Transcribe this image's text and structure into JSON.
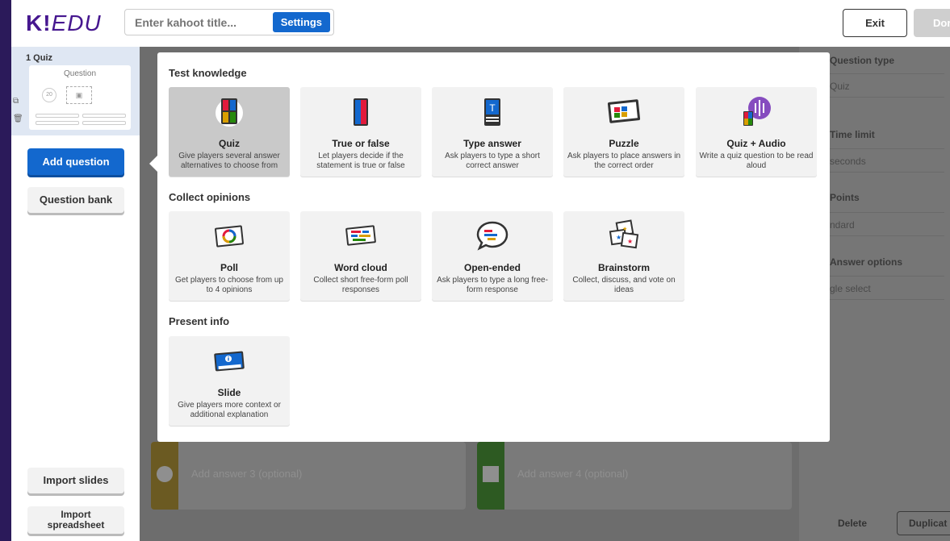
{
  "header": {
    "logo": "K!EDU",
    "logo_k": "K",
    "logo_excl": "!",
    "logo_edu": "EDU",
    "title_placeholder": "Enter kahoot title...",
    "settings_label": "Settings",
    "exit_label": "Exit",
    "done_label": "Dor"
  },
  "sidebar": {
    "slide_number": "1  Quiz",
    "slide_card_label": "Question",
    "slide_card_timer": "20",
    "add_question": "Add question",
    "question_bank": "Question bank",
    "import_slides": "Import slides",
    "import_spreadsheet_line1": "Import",
    "import_spreadsheet_line2": "spreadsheet"
  },
  "canvas": {
    "answers": [
      {
        "label": "Add answer 3 (optional)",
        "color": "#d89e00"
      },
      {
        "label": "Add answer 4 (optional)",
        "color": "#26890c"
      }
    ]
  },
  "right_panel": {
    "question_type_label": "Question type",
    "question_type_value": "Quiz",
    "time_limit_label": "Time limit",
    "time_limit_value": "seconds",
    "points_label": "Points",
    "points_value": "ndard",
    "answer_options_label": "Answer options",
    "answer_options_value": "gle select",
    "delete_label": "Delete",
    "duplicate_label": "Duplicat"
  },
  "modal": {
    "sections": [
      {
        "title": "Test knowledge",
        "cards": [
          {
            "name": "Quiz",
            "desc": "Give players several answer alternatives to choose from",
            "icon": "quiz-icon",
            "selected": true
          },
          {
            "name": "True or false",
            "desc": "Let players decide if the statement is true or false",
            "icon": "true-false-icon"
          },
          {
            "name": "Type answer",
            "desc": "Ask players to type a short correct answer",
            "icon": "type-answer-icon"
          },
          {
            "name": "Puzzle",
            "desc": "Ask players to place answers in the correct order",
            "icon": "puzzle-icon"
          },
          {
            "name": "Quiz + Audio",
            "desc": "Write a quiz question to be read aloud",
            "icon": "quiz-audio-icon"
          }
        ]
      },
      {
        "title": "Collect opinions",
        "cards": [
          {
            "name": "Poll",
            "desc": "Get players to choose from up to 4 opinions",
            "icon": "poll-icon"
          },
          {
            "name": "Word cloud",
            "desc": "Collect short free-form poll responses",
            "icon": "word-cloud-icon"
          },
          {
            "name": "Open-ended",
            "desc": "Ask players to type a long free-form response",
            "icon": "open-ended-icon"
          },
          {
            "name": "Brainstorm",
            "desc": "Collect, discuss, and vote on ideas",
            "icon": "brainstorm-icon"
          }
        ]
      },
      {
        "title": "Present info",
        "cards": [
          {
            "name": "Slide",
            "desc": "Give players more context or additional explanation",
            "icon": "slide-icon"
          }
        ]
      }
    ]
  },
  "colors": {
    "brand_purple": "#46178f",
    "primary_blue": "#1368ce",
    "kahoot_red": "#e21b3c",
    "kahoot_blue": "#1368ce",
    "kahoot_yellow": "#d89e00",
    "kahoot_green": "#26890c"
  }
}
